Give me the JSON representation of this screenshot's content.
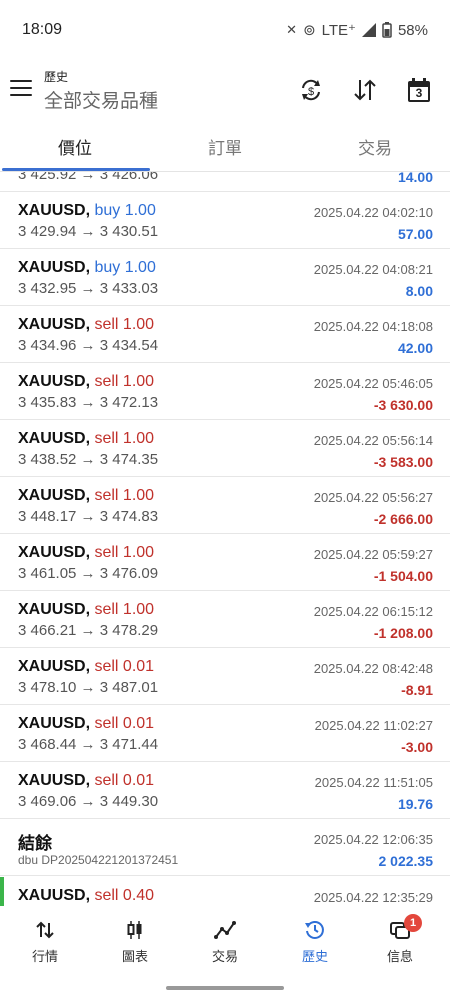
{
  "status": {
    "time": "18:09",
    "network": "LTE⁺",
    "battery": "58%"
  },
  "header": {
    "title": "歷史",
    "subtitle": "全部交易品種",
    "calendar_day": "3"
  },
  "tabs": [
    "價位",
    "訂單",
    "交易"
  ],
  "partial_row": {
    "prices": "3 425.92 → 3 426.06",
    "profit": "14.00"
  },
  "rows": [
    {
      "symbol": "XAUUSD,",
      "side": "buy",
      "volume": "buy 1.00",
      "prices": "3 429.94 → 3 430.51",
      "date": "2025.04.22 04:02:10",
      "profit": "57.00",
      "sign": "pos"
    },
    {
      "symbol": "XAUUSD,",
      "side": "buy",
      "volume": "buy 1.00",
      "prices": "3 432.95 → 3 433.03",
      "date": "2025.04.22 04:08:21",
      "profit": "8.00",
      "sign": "pos"
    },
    {
      "symbol": "XAUUSD,",
      "side": "sell",
      "volume": "sell 1.00",
      "prices": "3 434.96 → 3 434.54",
      "date": "2025.04.22 04:18:08",
      "profit": "42.00",
      "sign": "pos"
    },
    {
      "symbol": "XAUUSD,",
      "side": "sell",
      "volume": "sell 1.00",
      "prices": "3 435.83 → 3 472.13",
      "date": "2025.04.22 05:46:05",
      "profit": "-3 630.00",
      "sign": "neg"
    },
    {
      "symbol": "XAUUSD,",
      "side": "sell",
      "volume": "sell 1.00",
      "prices": "3 438.52 → 3 474.35",
      "date": "2025.04.22 05:56:14",
      "profit": "-3 583.00",
      "sign": "neg"
    },
    {
      "symbol": "XAUUSD,",
      "side": "sell",
      "volume": "sell 1.00",
      "prices": "3 448.17 → 3 474.83",
      "date": "2025.04.22 05:56:27",
      "profit": "-2 666.00",
      "sign": "neg"
    },
    {
      "symbol": "XAUUSD,",
      "side": "sell",
      "volume": "sell 1.00",
      "prices": "3 461.05 → 3 476.09",
      "date": "2025.04.22 05:59:27",
      "profit": "-1 504.00",
      "sign": "neg"
    },
    {
      "symbol": "XAUUSD,",
      "side": "sell",
      "volume": "sell 1.00",
      "prices": "3 466.21 → 3 478.29",
      "date": "2025.04.22 06:15:12",
      "profit": "-1 208.00",
      "sign": "neg"
    },
    {
      "symbol": "XAUUSD,",
      "side": "sell",
      "volume": "sell 0.01",
      "prices": "3 478.10 → 3 487.01",
      "date": "2025.04.22 08:42:48",
      "profit": "-8.91",
      "sign": "neg"
    },
    {
      "symbol": "XAUUSD,",
      "side": "sell",
      "volume": "sell 0.01",
      "prices": "3 468.44 → 3 471.44",
      "date": "2025.04.22 11:02:27",
      "profit": "-3.00",
      "sign": "neg"
    },
    {
      "symbol": "XAUUSD,",
      "side": "sell",
      "volume": "sell 0.01",
      "prices": "3 469.06 → 3 449.30",
      "date": "2025.04.22 11:51:05",
      "profit": "19.76",
      "sign": "pos"
    }
  ],
  "balance_row": {
    "label": "結餘",
    "ref": "dbu DP202504221201372451",
    "date": "2025.04.22 12:06:35",
    "amount": "2 022.35"
  },
  "last_row": {
    "symbol": "XAUUSD,",
    "volume": "sell 0.40",
    "date": "2025.04.22 12:35:29"
  },
  "nav": [
    {
      "label": "行情",
      "icon": "quotes-icon"
    },
    {
      "label": "圖表",
      "icon": "chart-icon"
    },
    {
      "label": "交易",
      "icon": "trade-icon"
    },
    {
      "label": "歷史",
      "icon": "history-icon"
    },
    {
      "label": "信息",
      "icon": "messages-icon",
      "badge": "1"
    }
  ],
  "colors": {
    "accent": "#2f6fd6",
    "loss": "#c0312b",
    "indicator": "#3b6fd1"
  }
}
